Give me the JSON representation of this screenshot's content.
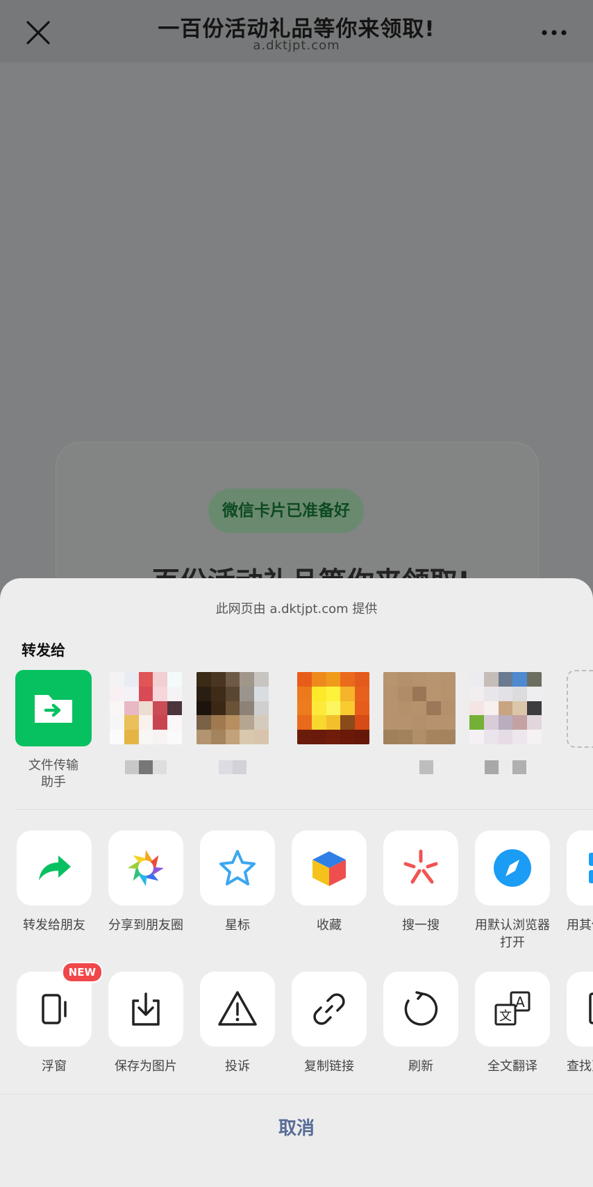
{
  "topbar": {
    "title": "一百份活动礼品等你来领取!",
    "domain": "a.dktjpt.com"
  },
  "background_card": {
    "ready_label": "微信卡片已准备好",
    "title": "一百份活动礼品等你来领取!"
  },
  "sheet": {
    "provider_text": "此网页由 a.dktjpt.com 提供",
    "forward_label": "转发给",
    "contacts": [
      {
        "name": "文件传输助手",
        "icon": "folder-arrow-icon",
        "color": "#07c160"
      }
    ],
    "actions_row1": [
      {
        "label": "转发给朋友",
        "icon": "share-arrow-icon",
        "color": "#07c160"
      },
      {
        "label": "分享到朋友圈",
        "icon": "moments-icon"
      },
      {
        "label": "星标",
        "icon": "star-icon",
        "color": "#3aa7f0"
      },
      {
        "label": "收藏",
        "icon": "favorite-cube-icon"
      },
      {
        "label": "搜一搜",
        "icon": "search-spark-icon",
        "color": "#f05454"
      },
      {
        "label": "用默认浏览器打开",
        "icon": "compass-icon",
        "color": "#1b9cf5"
      },
      {
        "label": "用其他应用打开",
        "icon": "apps-icon",
        "color": "#1b9cf5"
      }
    ],
    "actions_row2": [
      {
        "label": "浮窗",
        "icon": "floating-window-icon",
        "badge": "NEW"
      },
      {
        "label": "保存为图片",
        "icon": "download-tray-icon"
      },
      {
        "label": "投诉",
        "icon": "warning-triangle-icon"
      },
      {
        "label": "复制链接",
        "icon": "link-icon"
      },
      {
        "label": "刷新",
        "icon": "refresh-icon"
      },
      {
        "label": "全文翻译",
        "icon": "translate-icon"
      },
      {
        "label": "查找页面内容",
        "icon": "find-icon"
      }
    ],
    "cancel_label": "取消"
  }
}
